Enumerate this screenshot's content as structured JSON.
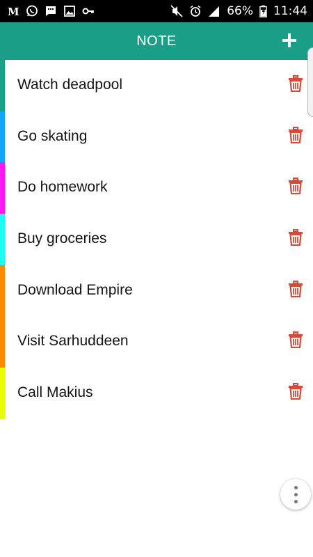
{
  "status_bar": {
    "battery_percent": "66%",
    "time": "11:44",
    "left_icons": [
      "m-app-icon",
      "whatsapp-icon",
      "message-icon",
      "image-icon",
      "key-icon"
    ],
    "right_icons": [
      "mute-icon",
      "alarm-icon",
      "signal-icon",
      "battery-icon"
    ]
  },
  "app_bar": {
    "title": "NOTE",
    "add_icon": "plus-icon",
    "background": "#1b9e88"
  },
  "notes": [
    {
      "text": "Watch deadpool",
      "color": "#1b9e88"
    },
    {
      "text": "Go skating",
      "color": "#19a5f5"
    },
    {
      "text": "Do homework",
      "color": "#ff1aee"
    },
    {
      "text": "Buy groceries",
      "color": "#1dfaf7"
    },
    {
      "text": "Download Empire",
      "color": "#ff8a00"
    },
    {
      "text": "Visit Sarhuddeen",
      "color": "#ff8a00"
    },
    {
      "text": "Call Makius",
      "color": "#e8ff00"
    }
  ],
  "delete_icon_color": "#d64a3c",
  "overflow_menu_icon": "vertical-dots-icon"
}
